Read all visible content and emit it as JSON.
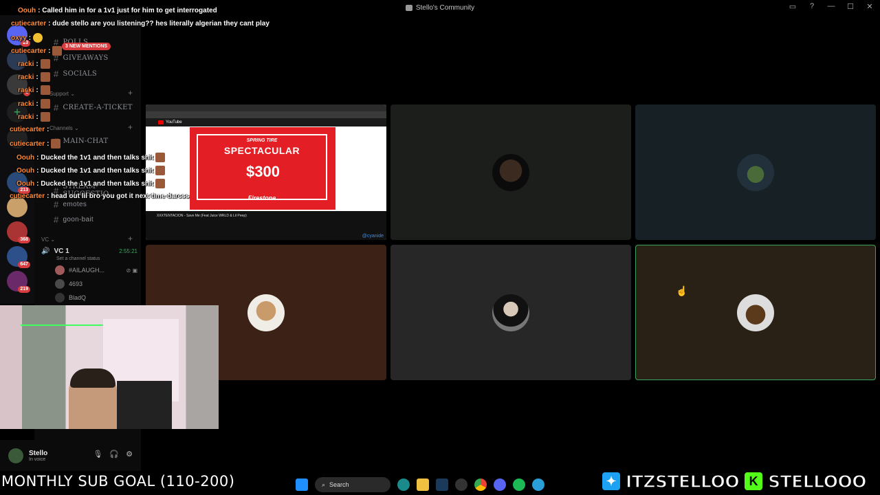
{
  "window": {
    "title": "Stello's Community"
  },
  "chat": [
    {
      "user": "Oouh",
      "text": ": Called him in for a 1v1 just for him to get interrogated"
    },
    {
      "user": "cutiecarter",
      "text": ": dude stello are you listening?? hes literally algerian they cant play"
    },
    {
      "user": "oxyy",
      "text": ":"
    },
    {
      "user": "cutiecarter",
      "text": ":"
    },
    {
      "user": "racki",
      "text": ":"
    },
    {
      "user": "racki",
      "text": ":"
    },
    {
      "user": "racki",
      "text": ":"
    },
    {
      "user": "racki",
      "text": ":"
    },
    {
      "user": "racki",
      "text": ":"
    },
    {
      "user": "cutiecarter",
      "text": ":"
    },
    {
      "user": "cutiecarter",
      "text": ":"
    },
    {
      "user": "Oouh",
      "text": ": Ducked the 1v1 and then talks shit"
    },
    {
      "user": "Oouh",
      "text": ": Ducked the 1v1 and then talks shit"
    },
    {
      "user": "Oouh",
      "text": ": Ducked the 1v1 and then talks shit"
    },
    {
      "user": "cutiecarter",
      "text": ": head out lil bro you got it next time darcss"
    }
  ],
  "sidebar": {
    "mentions_badge": "3 NEW MENTIONS",
    "channels": [
      {
        "name": "POLLS"
      },
      {
        "name": "GIVEAWAYS"
      },
      {
        "name": "SOCIALS"
      },
      {
        "name": "CREATE-A-TICKET"
      },
      {
        "name": "MAIN-CHAT"
      },
      {
        "name": "STREAM-SUGGESTIO..."
      },
      {
        "name": "emotes"
      },
      {
        "name": "goon-bait"
      }
    ],
    "categories": {
      "support": "Support",
      "channels": "Channels",
      "vc": "VC"
    },
    "voice": {
      "name": "VC 1",
      "timer": "2:55:21",
      "status": "Set a channel status",
      "users": [
        "#AILAUGH...",
        "4693",
        "BladQ"
      ]
    }
  },
  "server_badges": [
    "23",
    "1",
    "213",
    "368",
    "647",
    "219"
  ],
  "screenshare": {
    "yt_label": "YouTube",
    "ad_subtitle": "SPRING TIRE",
    "ad_title": "SPECTACULAR",
    "ad_price": "$300",
    "ad_brand": "Firestone",
    "caption": "XXXTENTACION - Save Me (Feat Juice WRLD & Lil Peep)",
    "watermark": "@cyanide"
  },
  "user_panel": {
    "name": "Stello",
    "status": "In voice"
  },
  "sub_goal": "MONTHLY SUB GOAL (110-200)",
  "taskbar": {
    "search": "Search"
  },
  "socials": {
    "twitter": "ITZSTELLOO",
    "kick": "STELLOOO",
    "kick_letter": "K"
  },
  "colors": {
    "accent_green": "#3ba55d",
    "chat_user": "#ff8c3b",
    "mention_red": "#d83c3e",
    "kick_green": "#53fc18",
    "twitter_blue": "#1da1f2"
  }
}
